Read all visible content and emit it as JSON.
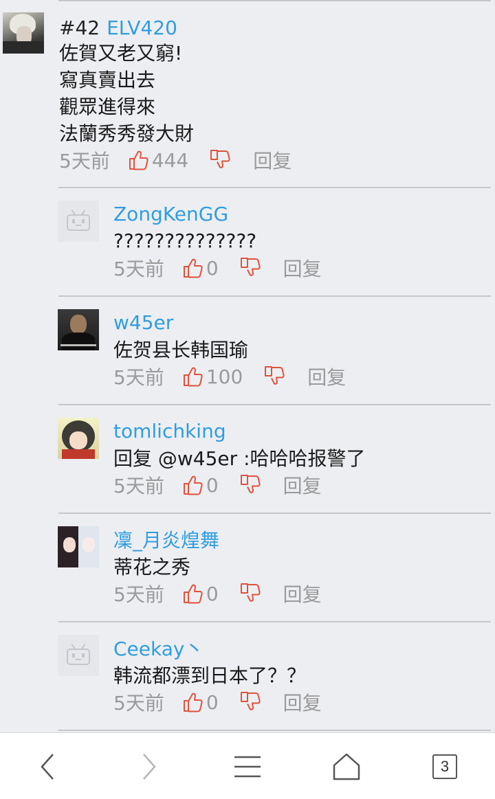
{
  "main_comment": {
    "floor": "#42",
    "username": "ELV420",
    "text_lines": "佐賀又老又窮!\n寫真賣出去\n觀眾進得來\n法蘭秀秀發大財",
    "time": "5天前",
    "likes": "444",
    "reply_label": "回复"
  },
  "replies": [
    {
      "username": "ZongKenGG",
      "text": "??????????????",
      "time": "5天前",
      "likes": "0",
      "reply_label": "回复",
      "avatar": "default-tv-avatar"
    },
    {
      "username": "w45er",
      "text": "佐贺县长韩国瑜",
      "time": "5天前",
      "likes": "100",
      "reply_label": "回复",
      "avatar": "man-photo-avatar"
    },
    {
      "username": "tomlichking",
      "text": "回复 @w45er :哈哈哈报警了",
      "time": "5天前",
      "likes": "0",
      "reply_label": "回复",
      "avatar": "anime-girl-avatar"
    },
    {
      "username": "凜_月炎煌舞",
      "text": "蒂花之秀",
      "time": "5天前",
      "likes": "0",
      "reply_label": "回复",
      "avatar": "anime-duo-avatar"
    },
    {
      "username": "Ceekay丶",
      "text": "韩流都漂到日本了？？",
      "time": "5天前",
      "likes": "0",
      "reply_label": "回复",
      "avatar": "default-tv-avatar"
    }
  ],
  "bottom_nav": {
    "tab_count": "3",
    "icons": [
      "back-arrow-icon",
      "forward-arrow-icon",
      "menu-icon",
      "home-icon",
      "tabs-icon"
    ]
  },
  "colors": {
    "username": "#2f9de1",
    "like_icon": "#e0523b",
    "meta_text": "#9a9a9a",
    "background": "#edeef2"
  }
}
